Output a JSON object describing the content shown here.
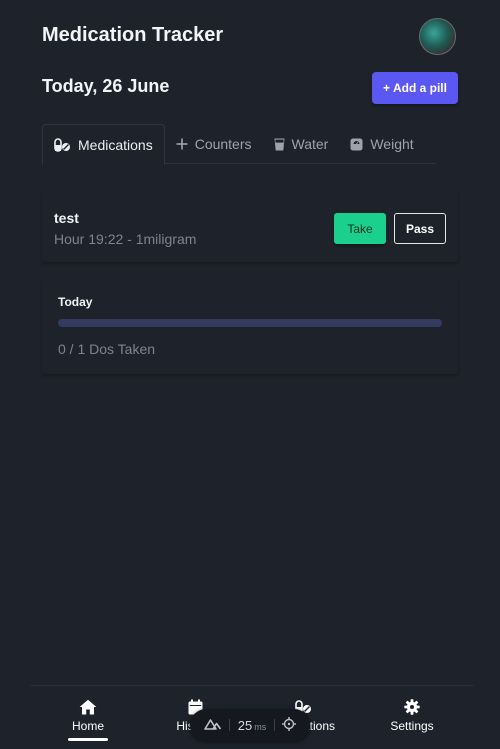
{
  "header": {
    "title": "Medication Tracker",
    "date": "Today, 26 June",
    "add_button": "+ Add a pill"
  },
  "tabs": [
    {
      "label": "Medications",
      "icon": "pills-icon",
      "active": true
    },
    {
      "label": "Counters",
      "icon": "plus-icon",
      "active": false
    },
    {
      "label": "Water",
      "icon": "glass-icon",
      "active": false
    },
    {
      "label": "Weight",
      "icon": "scale-icon",
      "active": false
    }
  ],
  "medication": {
    "name": "test",
    "details": "Hour 19:22 - 1miligram",
    "take_label": "Take",
    "pass_label": "Pass"
  },
  "progress": {
    "label": "Today",
    "text": "0 / 1 Dos Taken",
    "taken": 0,
    "total": 1
  },
  "bottom_nav": {
    "items": [
      {
        "label": "Home",
        "icon": "home-icon",
        "active": true
      },
      {
        "label": "History",
        "icon": "calendar-icon",
        "active": false
      },
      {
        "label": "Medications",
        "icon": "pills-icon",
        "active": false
      },
      {
        "label": "Settings",
        "icon": "gear-icon",
        "active": false
      }
    ]
  },
  "devtools": {
    "value": "25",
    "unit": "ms"
  },
  "colors": {
    "background": "#1e232b",
    "accent": "#5b57f2",
    "take": "#1bcf8c"
  }
}
